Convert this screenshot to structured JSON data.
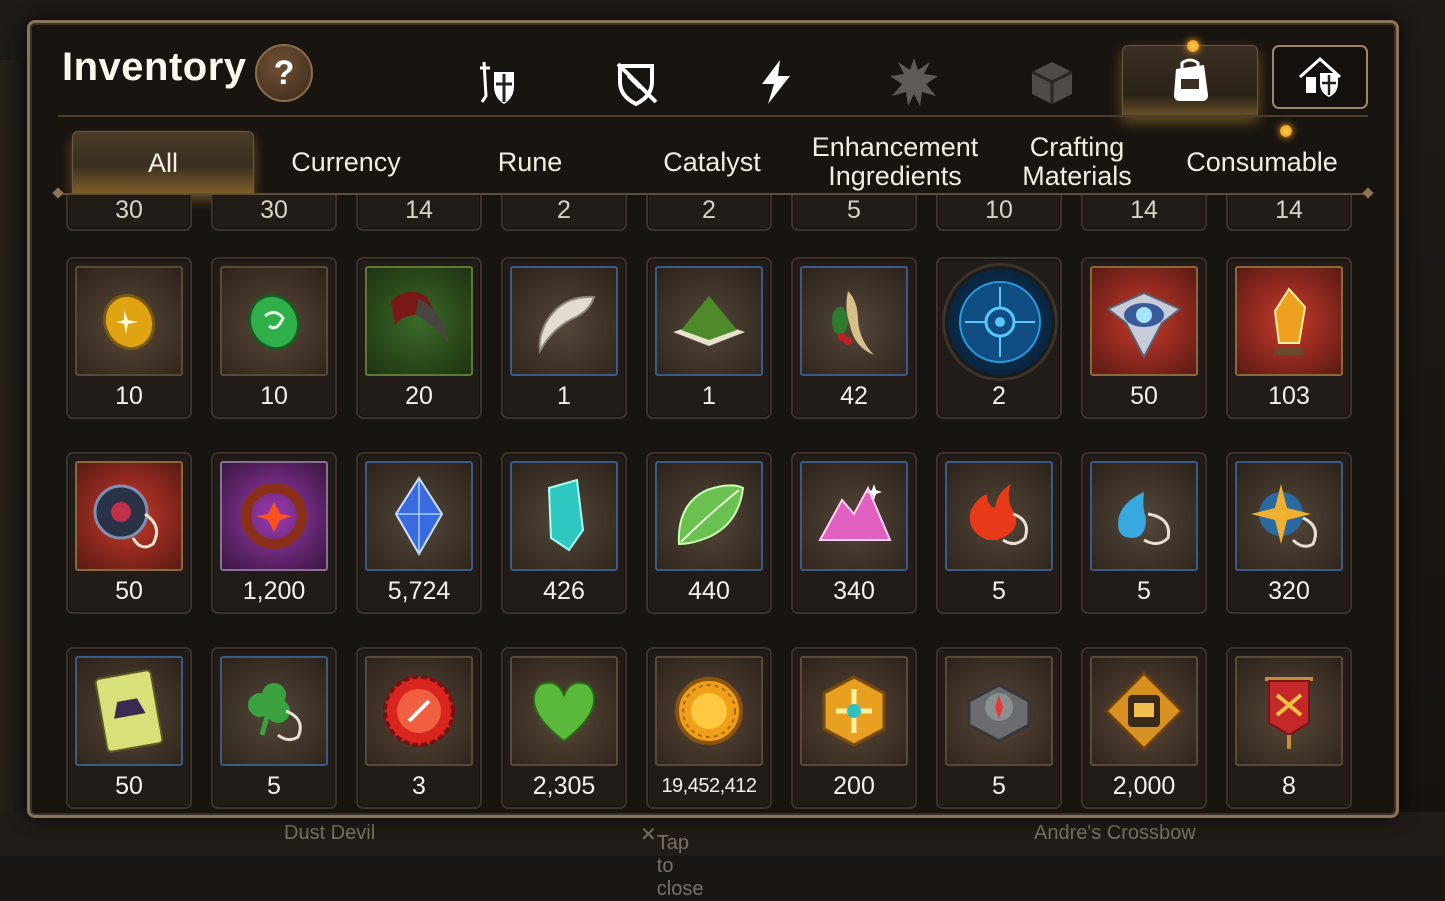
{
  "panel": {
    "title": "Inventory",
    "help_label": "?"
  },
  "categories": [
    {
      "icon": "knight-shield-icon",
      "active": false
    },
    {
      "icon": "broken-shield-icon",
      "active": false
    },
    {
      "icon": "lightning-icon",
      "active": false
    },
    {
      "icon": "burst-emblem-icon",
      "active": false
    },
    {
      "icon": "cube-icon",
      "active": false
    },
    {
      "icon": "backpack-icon",
      "active": true,
      "notification": true
    },
    {
      "icon": "house-shield-icon",
      "active": false
    }
  ],
  "tabs": [
    {
      "label": "All",
      "active": true
    },
    {
      "label": "Currency"
    },
    {
      "label": "Rune"
    },
    {
      "label": "Catalyst"
    },
    {
      "label": "Enhancement Ingredients"
    },
    {
      "label": "Crafting Materials"
    },
    {
      "label": "Consumable",
      "notification": true
    }
  ],
  "grid": {
    "partial_row": [
      "30",
      "30",
      "14",
      "2",
      "2",
      "5",
      "10",
      "14",
      "14"
    ],
    "rows": [
      [
        {
          "icon": "amber-gem-icon",
          "count": "10"
        },
        {
          "icon": "green-gem-icon",
          "count": "10"
        },
        {
          "icon": "claw-icon",
          "count": "20"
        },
        {
          "icon": "fang-icon",
          "count": "1"
        },
        {
          "icon": "green-mound-icon",
          "count": "1"
        },
        {
          "icon": "root-herb-icon",
          "count": "42"
        },
        {
          "icon": "blue-rune-disc-icon",
          "count": "2"
        },
        {
          "icon": "eye-crest-icon",
          "count": "50"
        },
        {
          "icon": "amber-crystal-icon",
          "count": "103"
        }
      ],
      [
        {
          "icon": "dark-ring-pendant-icon",
          "count": "50"
        },
        {
          "icon": "red-flower-ring-icon",
          "count": "1,200"
        },
        {
          "icon": "blue-crystal-icon",
          "count": "5,724"
        },
        {
          "icon": "teal-crystal-icon",
          "count": "426"
        },
        {
          "icon": "green-leaf-icon",
          "count": "440"
        },
        {
          "icon": "pink-crystal-cluster-icon",
          "count": "340"
        },
        {
          "icon": "fire-pendant-icon",
          "count": "5"
        },
        {
          "icon": "water-pendant-icon",
          "count": "5"
        },
        {
          "icon": "star-pendant-icon",
          "count": "320"
        }
      ],
      [
        {
          "icon": "ticket-card-icon",
          "count": "50"
        },
        {
          "icon": "clover-pendant-icon",
          "count": "5"
        },
        {
          "icon": "red-bottlecap-icon",
          "count": "3"
        },
        {
          "icon": "green-heart-icon",
          "count": "2,305"
        },
        {
          "icon": "gold-coin-icon",
          "count": "19,452,412"
        },
        {
          "icon": "gold-hex-emblem-icon",
          "count": "200"
        },
        {
          "icon": "stone-compass-icon",
          "count": "5"
        },
        {
          "icon": "fist-emblem-icon",
          "count": "2,000"
        },
        {
          "icon": "red-banner-icon",
          "count": "8"
        }
      ]
    ]
  },
  "background": {
    "bottom_left": "Dust Devil",
    "bottom_center": "Tap to close",
    "bottom_right": "Andre's Crossbow"
  },
  "colors": {
    "frame": "#8a7457",
    "accent_glow": "#ffbe46",
    "panel_bg": "#181410"
  }
}
